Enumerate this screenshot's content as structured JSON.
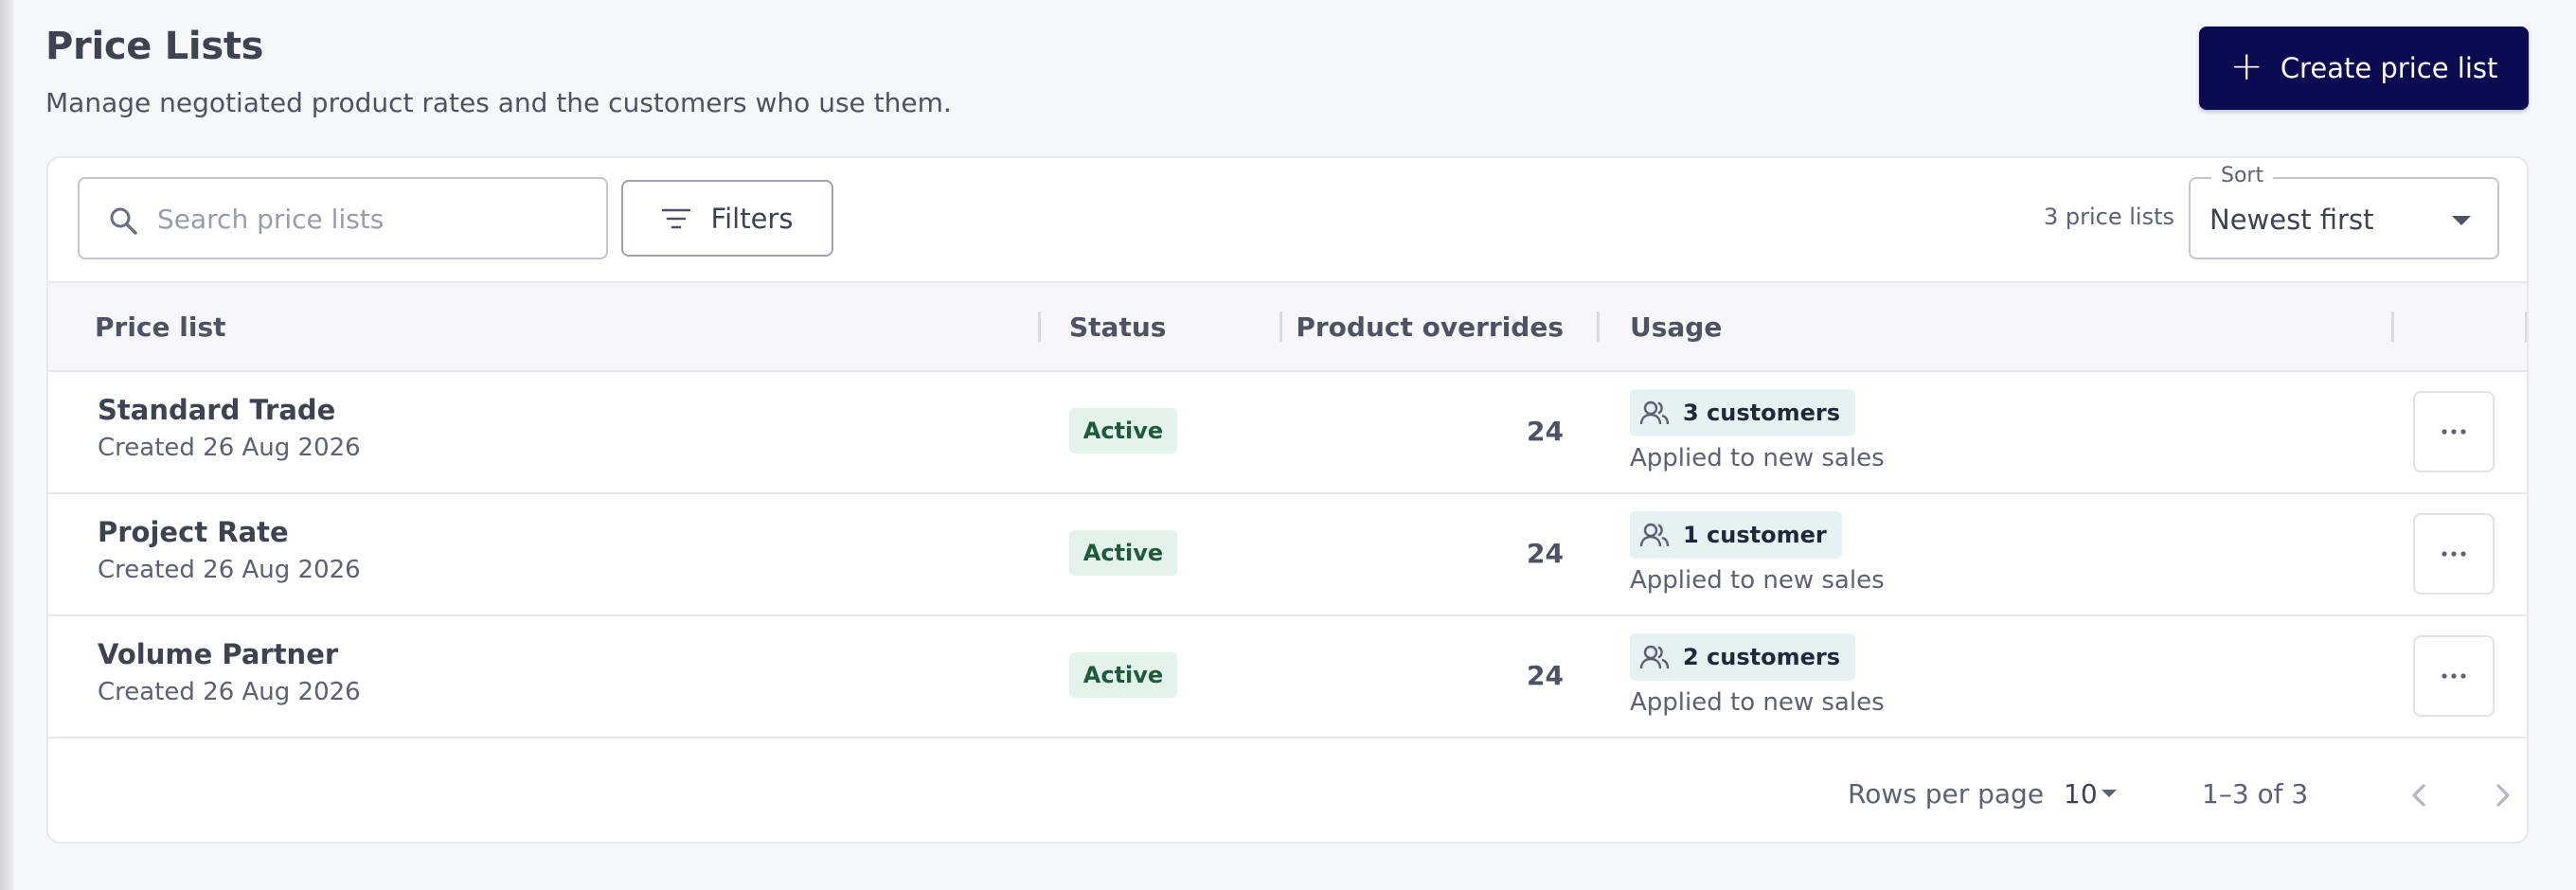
{
  "header": {
    "title": "Price Lists",
    "subtitle": "Manage negotiated product rates and the customers who use them.",
    "create_button_label": "Create price list"
  },
  "toolbar": {
    "search_placeholder": "Search price lists",
    "filters_label": "Filters",
    "count_label": "3 price lists",
    "sort_label": "Sort",
    "sort_value": "Newest first"
  },
  "table": {
    "columns": [
      "Price list",
      "Status",
      "Product overrides",
      "Usage"
    ],
    "rows": [
      {
        "name": "Standard Trade",
        "created": "Created 26 Aug 2026",
        "status": "Active",
        "overrides": "24",
        "usage": "3 customers",
        "usage_note": "Applied to new sales"
      },
      {
        "name": "Project Rate",
        "created": "Created 26 Aug 2026",
        "status": "Active",
        "overrides": "24",
        "usage": "1 customer",
        "usage_note": "Applied to new sales"
      },
      {
        "name": "Volume Partner",
        "created": "Created 26 Aug 2026",
        "status": "Active",
        "overrides": "24",
        "usage": "2 customers",
        "usage_note": "Applied to new sales"
      }
    ]
  },
  "pagination": {
    "rows_per_page_label": "Rows per page",
    "rows_per_page_value": "10",
    "range": "1–3 of 3"
  },
  "icons": {
    "create": "plus-icon",
    "search": "search-icon",
    "filters": "filter-lines-icon",
    "usage": "users-icon",
    "row_menu": "more-horizontal-icon",
    "prev": "chevron-left-icon",
    "next": "chevron-right-icon"
  },
  "colors": {
    "primary_button": "#0b0b52",
    "status_active_bg": "#e3f2ea",
    "status_active_text": "#1f5a3a",
    "usage_chip_bg": "#e6f2f2",
    "page_bg": "#f6f7f9"
  }
}
